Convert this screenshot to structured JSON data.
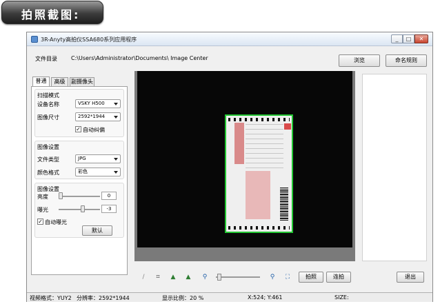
{
  "banner": {
    "title": "拍照截图:"
  },
  "window": {
    "title": "3R-Anyty高拍仪SSA680系列应用程序",
    "controls": {
      "minimize": "_",
      "maximize": "□",
      "close": "✕"
    }
  },
  "top": {
    "dir_label": "文件目录",
    "dir_path": "C:\\Users\\Administrator\\Documents\\ Image Center",
    "browse": "浏览",
    "naming": "命名规则"
  },
  "tabs": [
    "普通",
    "高级",
    "副摄像头"
  ],
  "scan": {
    "group_title": "扫描模式",
    "device_label": "设备名称",
    "device_value": "VSKY H500",
    "size_label": "图像尺寸",
    "size_value": "2592*1944",
    "autocorrect_label": "自动纠偏",
    "autocorrect_checked": true
  },
  "image_settings": {
    "group_title": "图像设置",
    "filetype_label": "文件类型",
    "filetype_value": "JPG",
    "color_label": "颜色格式",
    "color_value": "彩色"
  },
  "adjust": {
    "group_title": "图像设置",
    "brightness_label": "亮度",
    "brightness_value": "0",
    "exposure_label": "曝光",
    "exposure_value": "-3",
    "auto_exposure_label": "自动曝光",
    "auto_exposure_checked": true,
    "default_button": "默认"
  },
  "toolbar": {
    "icons": [
      "rotate-icon",
      "crop-icon",
      "rotate-left-icon",
      "rotate-right-icon",
      "zoom-out-icon",
      "zoom-in-icon",
      "fit-icon"
    ],
    "capture": "拍照",
    "burst": "连拍",
    "exit": "退出"
  },
  "status": {
    "video_format": "视频格式：YUY2",
    "resolution": "分辨率：2592*1944",
    "ratio": "显示比例：20 %",
    "coords": "X:524; Y:461",
    "size": "SIZE:"
  },
  "colors": {
    "accent_green": "#22c632",
    "banner_dark": "#2a2a2a"
  }
}
